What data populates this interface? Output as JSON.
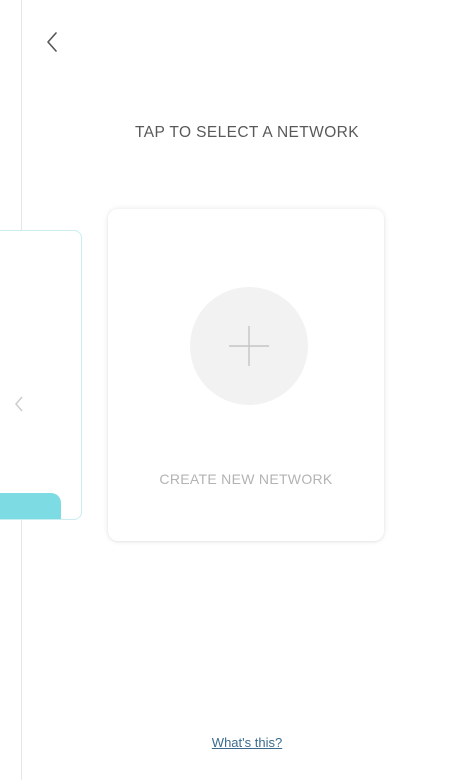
{
  "header": {
    "back_icon": "chevron-left-icon"
  },
  "main": {
    "title": "TAP TO SELECT A NETWORK",
    "cards": {
      "previous": {
        "accent_color": "#7ddbe3",
        "icon": "chevron-left-icon"
      },
      "create": {
        "icon": "plus-icon",
        "label": "CREATE NEW NETWORK"
      }
    }
  },
  "footer": {
    "help_link": "What's this?"
  },
  "colors": {
    "accent": "#7ddbe3",
    "link": "#3b6c8f",
    "title_text": "#595959",
    "muted_text": "#b3b3b3"
  }
}
